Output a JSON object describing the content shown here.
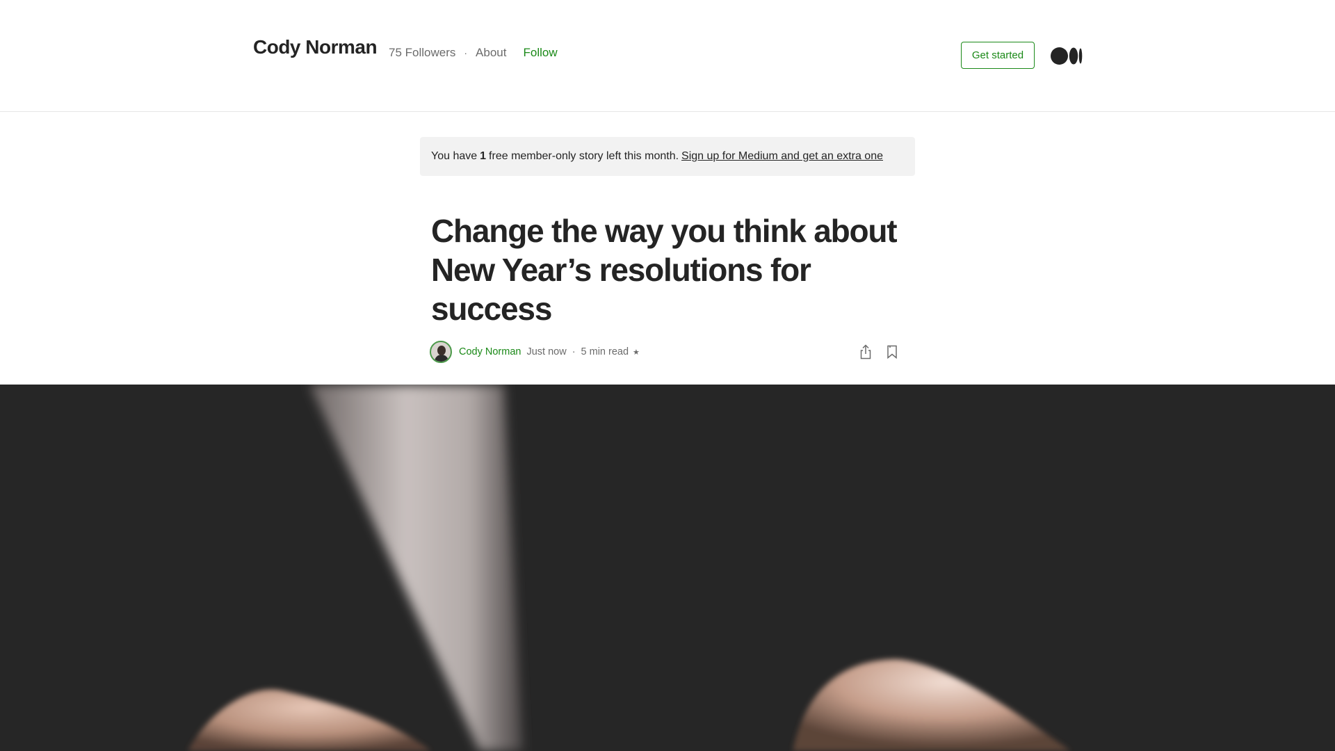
{
  "header": {
    "site_title": "Cody Norman",
    "followers": "75 Followers",
    "separator": "·",
    "about": "About",
    "follow": "Follow",
    "get_started": "Get started",
    "logo_icon": "medium-logo-icon"
  },
  "banner": {
    "prefix": "You have",
    "count": "1",
    "suffix": "free member-only story left this month.",
    "signup_link": "Sign up for Medium and get an extra one"
  },
  "article": {
    "title": "Change the way you think about New Year’s resolutions for success",
    "author": "Cody Norman",
    "time": "Just now",
    "separator": "·",
    "read_time": "5 min read",
    "member_star": "★",
    "share_icon": "share-icon",
    "bookmark_icon": "bookmark-icon"
  },
  "colors": {
    "accent": "#1a8917",
    "text": "#242424",
    "muted": "#6b6b6b",
    "banner_bg": "#f2f2f2",
    "hero_bg": "#262626"
  }
}
